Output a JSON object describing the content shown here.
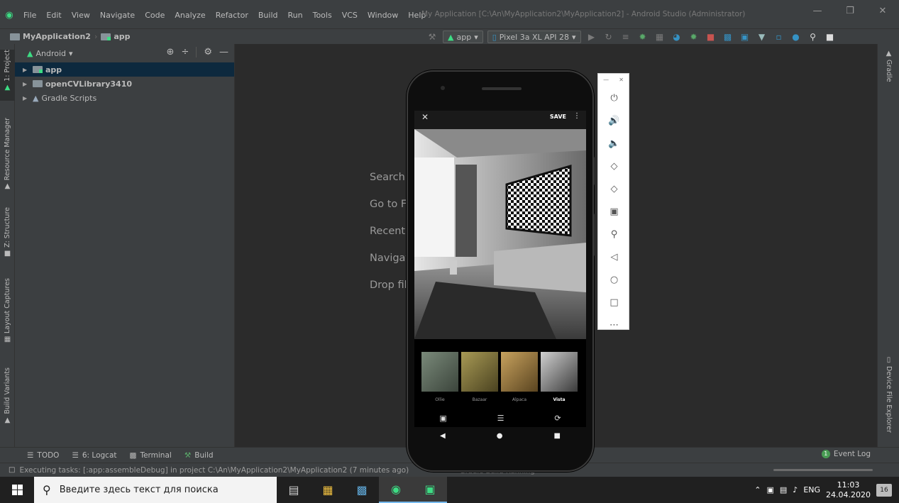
{
  "menu": [
    "File",
    "Edit",
    "View",
    "Navigate",
    "Code",
    "Analyze",
    "Refactor",
    "Build",
    "Run",
    "Tools",
    "VCS",
    "Window",
    "Help"
  ],
  "window_title": "My Application [C:\\An\\MyApplication2\\MyApplication2] - Android Studio (Administrator)",
  "breadcrumb": {
    "project": "MyApplication2",
    "module": "app"
  },
  "toolbar": {
    "run_config": "app",
    "device": "Pixel 3a XL API 28"
  },
  "left_tabs": [
    "1: Project",
    "Resource Manager",
    "Z: Structure",
    "Layout Captures",
    "Build Variants"
  ],
  "right_tabs": [
    "Gradle",
    "Device File Explorer"
  ],
  "project_panel": {
    "view_mode": "Android",
    "tree": [
      {
        "label": "app",
        "bold": true,
        "selected": true
      },
      {
        "label": "openCVLibrary3410",
        "bold": true,
        "selected": false
      },
      {
        "label": "Gradle Scripts",
        "bold": false,
        "selected": false
      }
    ]
  },
  "editor_hints": [
    "Search",
    "Go to F",
    "Recent",
    "Navigat",
    "Drop fil"
  ],
  "bottom_tabs": [
    "TODO",
    "6: Logcat",
    "Terminal",
    "Build"
  ],
  "event_log": {
    "label": "Event Log",
    "count": "1"
  },
  "status": {
    "text": "Executing tasks: [:app:assembleDebug] in project C:\\An\\MyApplication2\\MyApplication2 (7 minutes ago)",
    "ghost": "Gradle Build Running"
  },
  "taskbar": {
    "search_placeholder": "Введите здесь текст для поиска",
    "lang": "ENG",
    "time": "11:03",
    "date": "24.04.2020",
    "notifications": "16"
  },
  "phone": {
    "save_label": "SAVE",
    "filters": [
      {
        "name": "Ollie",
        "selected": false,
        "tint": "#7a8a7a"
      },
      {
        "name": "Bazaar",
        "selected": false,
        "tint": "#a89a55"
      },
      {
        "name": "Alpaca",
        "selected": false,
        "tint": "#c7a25e"
      },
      {
        "name": "Vista",
        "selected": true,
        "tint": "#8a8a8a"
      }
    ]
  },
  "colors": {
    "android_green": "#3ddc84",
    "selection": "#0d293e",
    "accent_blue": "#3592c4"
  }
}
